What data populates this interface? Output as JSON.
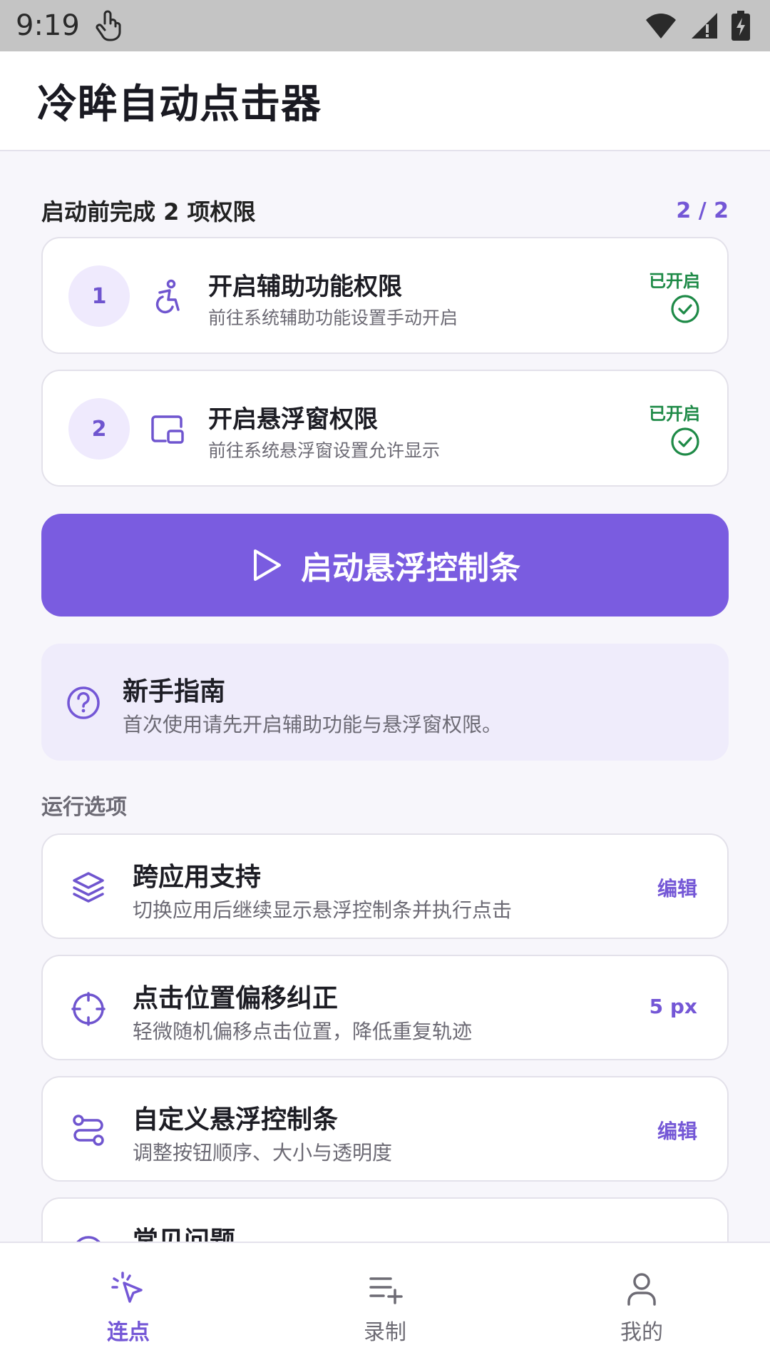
{
  "status_bar": {
    "time": "9:19"
  },
  "app": {
    "title": "冷眸自动点击器"
  },
  "permissions": {
    "header": "启动前完成 2 项权限",
    "count": "2 / 2",
    "items": [
      {
        "step": "1",
        "icon": "accessibility-icon",
        "title": "开启辅助功能权限",
        "subtitle": "前往系统辅助功能设置手动开启",
        "status": "已开启"
      },
      {
        "step": "2",
        "icon": "floating-window-icon",
        "title": "开启悬浮窗权限",
        "subtitle": "前往系统悬浮窗设置允许显示",
        "status": "已开启"
      }
    ]
  },
  "start_button": {
    "label": "启动悬浮控制条",
    "icon": "play-icon"
  },
  "guide": {
    "icon": "help-icon",
    "title": "新手指南",
    "subtitle": "首次使用请先开启辅助功能与悬浮窗权限。"
  },
  "options": {
    "section_label": "运行选项",
    "items": [
      {
        "icon": "layers-icon",
        "title": "跨应用支持",
        "subtitle": "切换应用后继续显示悬浮控制条并执行点击",
        "action": "编辑"
      },
      {
        "icon": "crosshair-icon",
        "title": "点击位置偏移纠正",
        "subtitle": "轻微随机偏移点击位置，降低重复轨迹",
        "action": "5 px"
      },
      {
        "icon": "route-icon",
        "title": "自定义悬浮控制条",
        "subtitle": "调整按钮顺序、大小与透明度",
        "action": "编辑"
      },
      {
        "icon": "faq-icon",
        "title": "常见问题",
        "subtitle": "",
        "action": ""
      }
    ]
  },
  "bottom_nav": {
    "items": [
      {
        "icon": "tap-icon",
        "label": "连点",
        "active": true
      },
      {
        "icon": "record-list-icon",
        "label": "录制",
        "active": false
      },
      {
        "icon": "profile-icon",
        "label": "我的",
        "active": false
      }
    ]
  },
  "colors": {
    "accent": "#7a5ce0",
    "success": "#1e8a47",
    "background": "#f7f6fb"
  }
}
